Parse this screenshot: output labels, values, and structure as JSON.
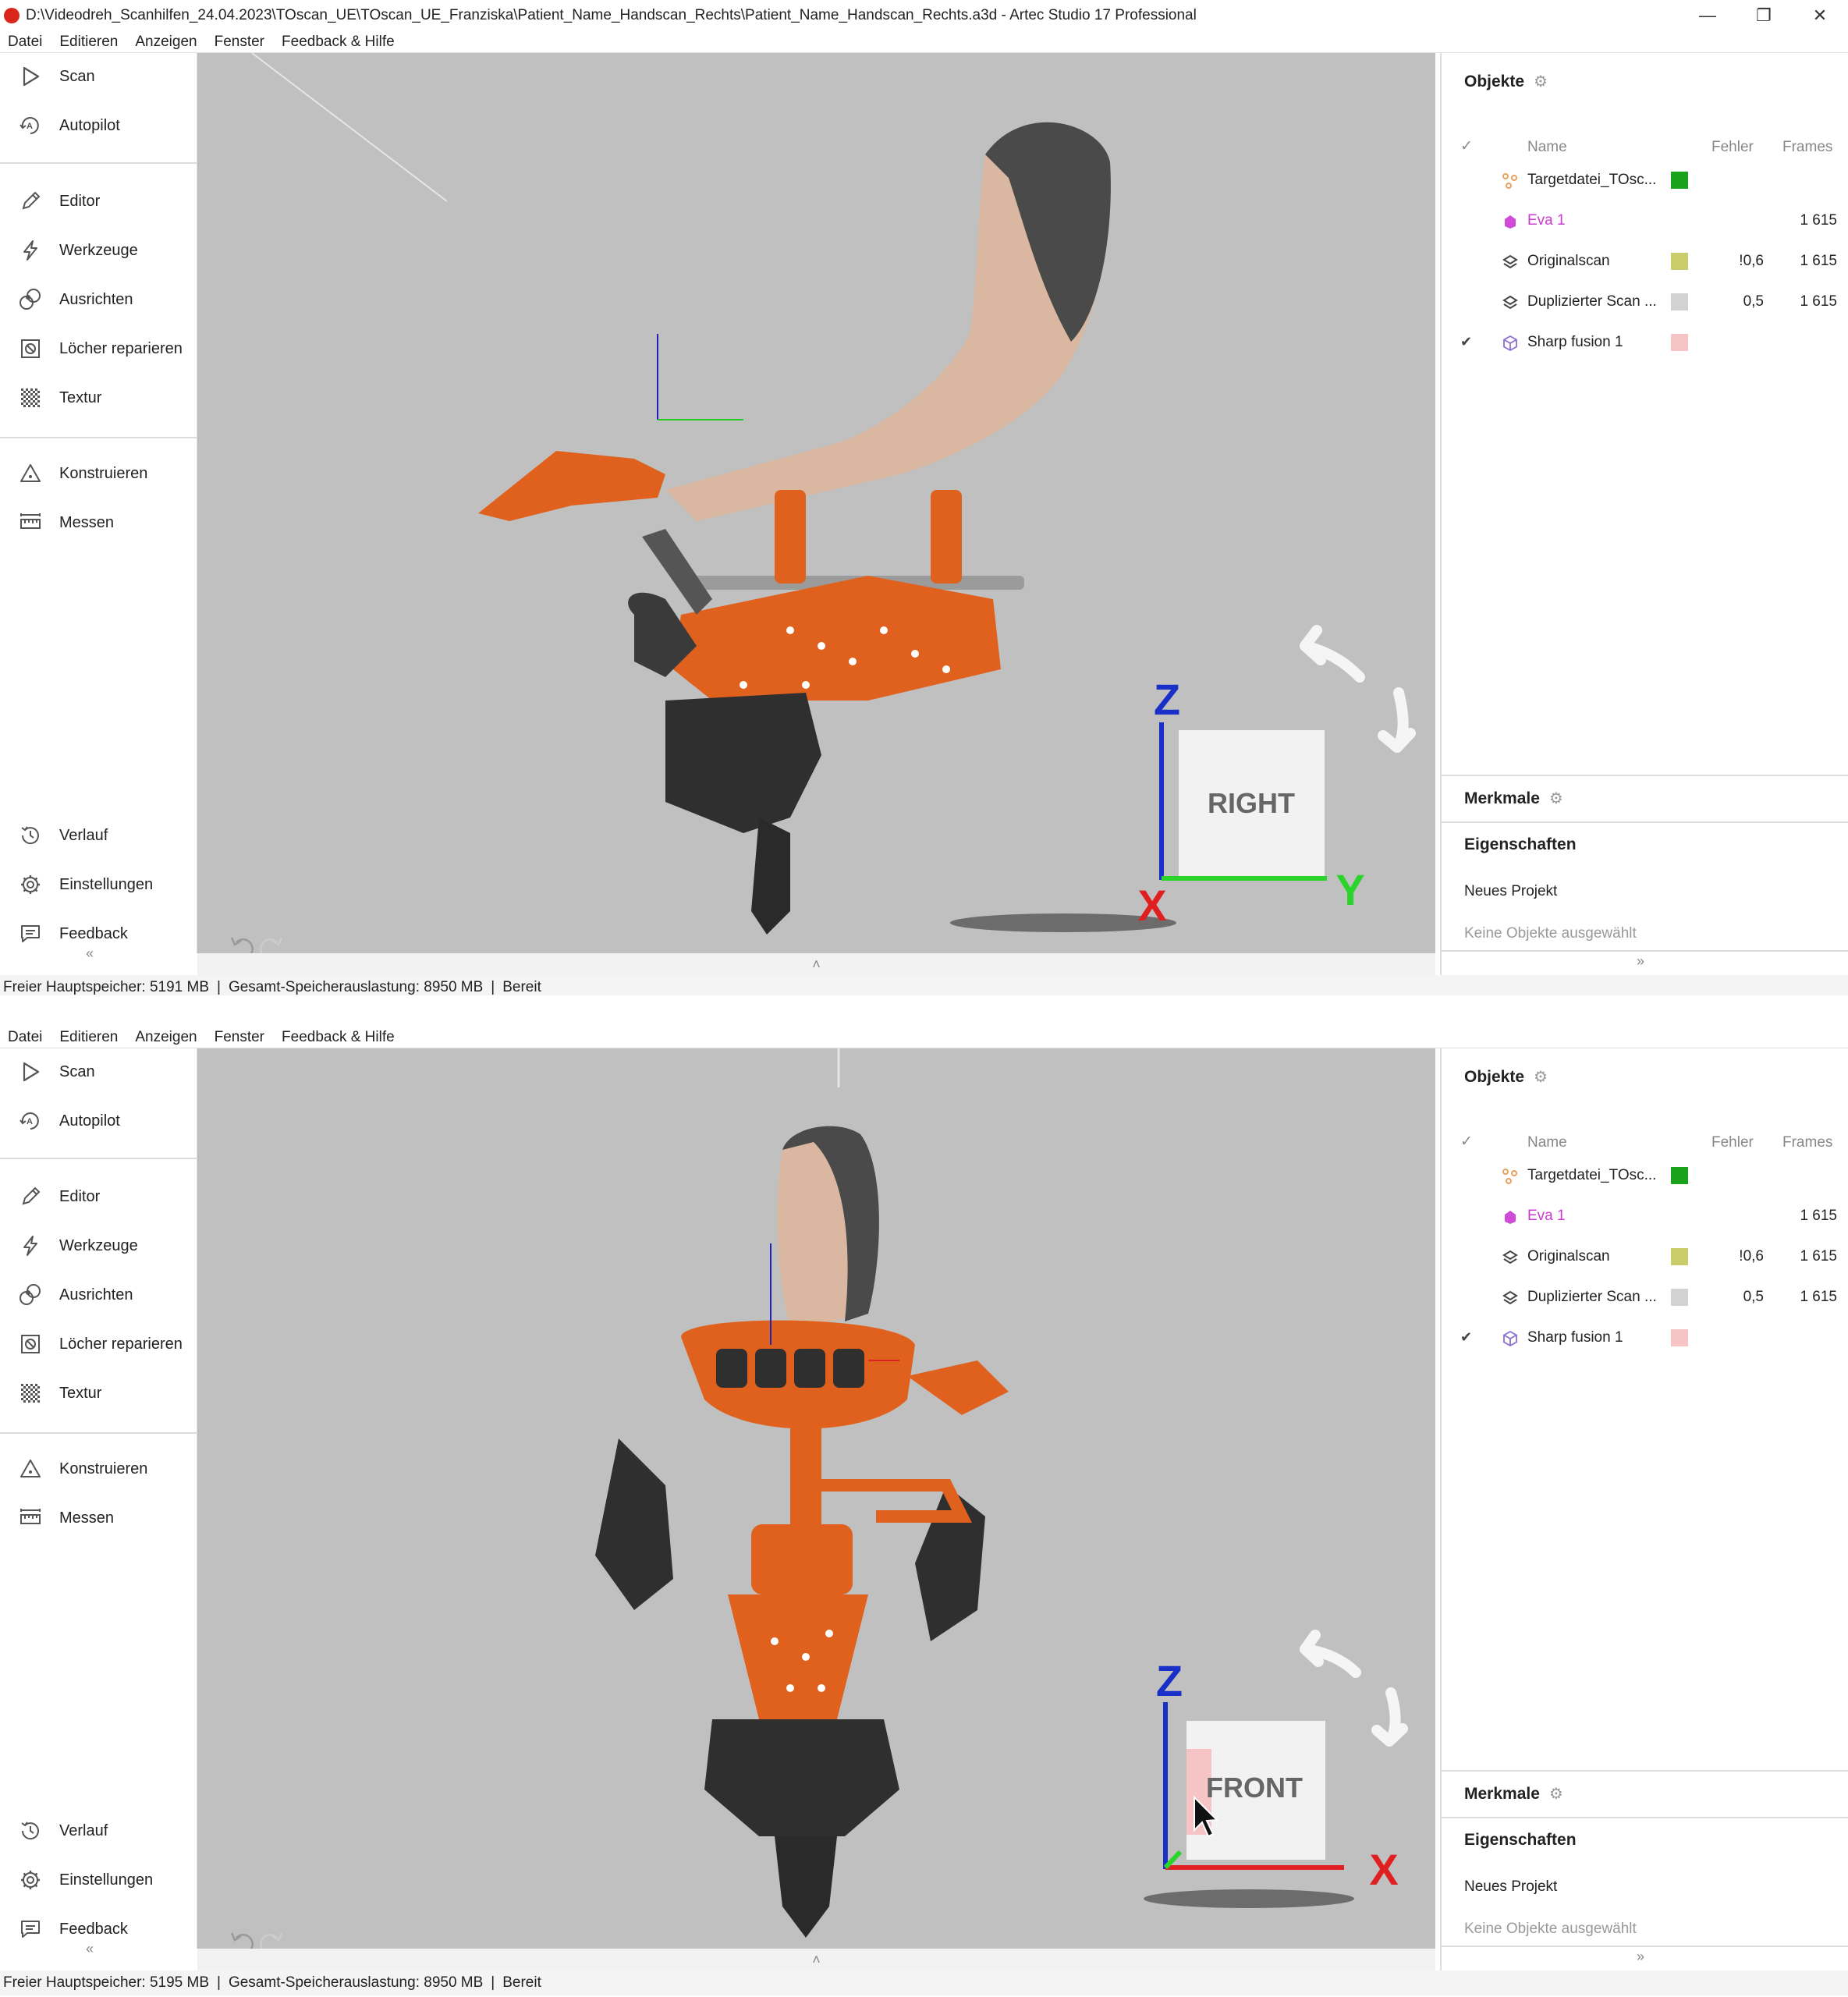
{
  "window": {
    "title": "D:\\Videodreh_Scanhilfen_24.04.2023\\TOscan_UE\\TOscan_UE_Franziska\\Patient_Name_Handscan_Rechts\\Patient_Name_Handscan_Rechts.a3d - Artec Studio 17 Professional",
    "controls": [
      "—",
      "❐",
      "✕"
    ]
  },
  "menu": [
    "Datei",
    "Editieren",
    "Anzeigen",
    "Fenster",
    "Feedback & Hilfe"
  ],
  "nav": {
    "scan": "Scan",
    "autopilot": "Autopilot",
    "editor": "Editor",
    "werkzeuge": "Werkzeuge",
    "ausrichten": "Ausrichten",
    "loecher": "Löcher reparieren",
    "textur": "Textur",
    "konstruieren": "Konstruieren",
    "messen": "Messen",
    "verlauf": "Verlauf",
    "einstellungen": "Einstellungen",
    "feedback": "Feedback",
    "collapse": "«"
  },
  "objects_panel": {
    "title": "Objekte",
    "columns": {
      "check": "✓",
      "name": "Name",
      "error": "Fehler",
      "frames": "Frames"
    },
    "rows": [
      {
        "name": "Targetdatei_TOsc...",
        "icon": "targets-icon",
        "color": "#1aa31a",
        "error": "",
        "frames": "",
        "checked": ""
      },
      {
        "name": "Eva 1",
        "icon": "scanner-icon",
        "color": "",
        "error": "",
        "frames": "1 615",
        "checked": "",
        "name_color": "#c93ccf"
      },
      {
        "name": "Originalscan",
        "icon": "scan-layers-icon",
        "color": "#c8cc6a",
        "error": "!0,6",
        "frames": "1 615",
        "checked": ""
      },
      {
        "name": "Duplizierter Scan ...",
        "icon": "scan-layers-icon",
        "color": "#d2d2d2",
        "error": "0,5",
        "frames": "1 615",
        "checked": ""
      },
      {
        "name": "Sharp fusion 1",
        "icon": "model-cube-icon",
        "color": "#f6c4c4",
        "error": "",
        "frames": "",
        "checked": "✔"
      }
    ]
  },
  "features_panel": {
    "title": "Merkmale"
  },
  "properties_panel": {
    "title": "Eigenschaften",
    "project": "Neues Projekt",
    "selection": "Keine Objekte ausgewählt"
  },
  "collapse_right": "»",
  "collapse_up": "˄",
  "screens": [
    {
      "view_cube": {
        "face": "RIGHT",
        "axis_vertical": "Z",
        "axis_horizontal": "Y",
        "axis_corner": "X"
      },
      "status": {
        "free_mem": "Freier Hauptspeicher: 5191 MB",
        "total_mem": "Gesamt-Speicherauslastung: 8950 MB",
        "state": "Bereit",
        "sep": "|"
      }
    },
    {
      "view_cube": {
        "face": "FRONT",
        "axis_vertical": "Z",
        "axis_horizontal": "X",
        "axis_corner": ""
      },
      "status": {
        "free_mem": "Freier Hauptspeicher: 5195 MB",
        "total_mem": "Gesamt-Speicherauslastung: 8950 MB",
        "state": "Bereit",
        "sep": "|"
      }
    }
  ],
  "colors": {
    "accent": "#d9261c",
    "model_orange": "#e0611e",
    "viewport_bg": "#c0c0c0"
  }
}
